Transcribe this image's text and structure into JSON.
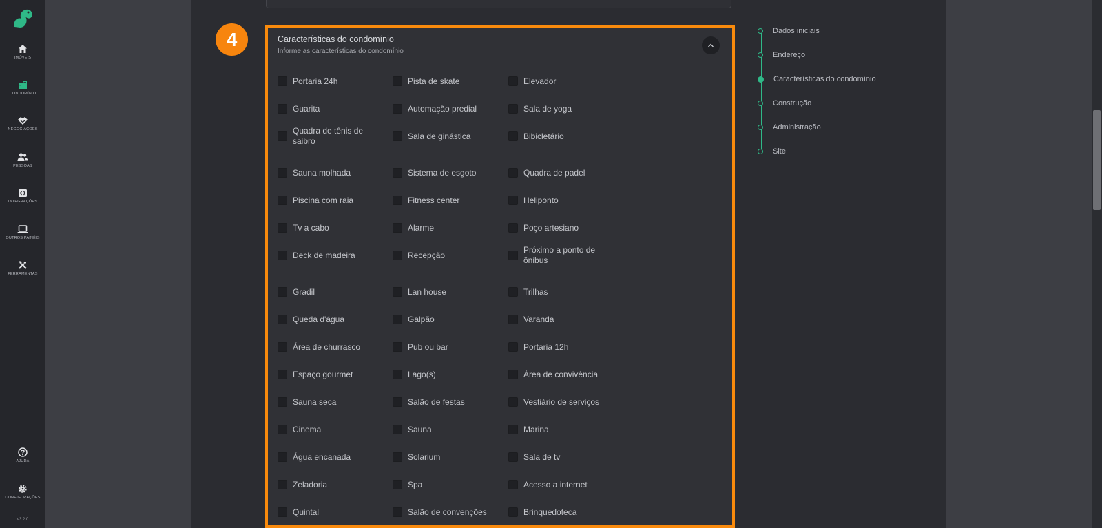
{
  "colors": {
    "accent": "#2fb887",
    "highlight": "#f98a0c",
    "sidebar_bg": "#25262b",
    "panel_bg": "#303136"
  },
  "sidebar": {
    "items": [
      {
        "label": "IMÓVEIS",
        "icon": "home-icon"
      },
      {
        "label": "CONDOMÍNIO",
        "icon": "building-icon",
        "active": true
      },
      {
        "label": "NEGOCIAÇÕES",
        "icon": "handshake-icon"
      },
      {
        "label": "PESSOAS",
        "icon": "people-icon"
      },
      {
        "label": "INTEGRAÇÕES",
        "icon": "integration-icon"
      },
      {
        "label": "OUTROS PAINÉIS",
        "icon": "laptop-icon"
      },
      {
        "label": "FERRAMENTAS",
        "icon": "tools-icon"
      }
    ],
    "bottom": [
      {
        "label": "AJUDA",
        "icon": "help-icon"
      },
      {
        "label": "CONFIGURAÇÕES",
        "icon": "gear-icon"
      }
    ],
    "version": "v3.2.0"
  },
  "step_badge": "4",
  "section": {
    "title": "Características do condomínio",
    "subtitle": "Informe as características do condomínio"
  },
  "features": {
    "col1": [
      "Portaria 24h",
      "Guarita",
      "Quadra de tênis de saibro",
      "Sauna molhada",
      "Piscina com raia",
      "Tv a cabo",
      "Deck de madeira",
      "Gradil",
      "Queda d'água",
      "Área de churrasco",
      "Espaço gourmet",
      "Sauna seca",
      "Cinema",
      "Água encanada",
      "Zeladoria",
      "Quintal"
    ],
    "col2": [
      "Pista de skate",
      "Automação predial",
      "Sala de ginástica",
      "Sistema de esgoto",
      "Fitness center",
      "Alarme",
      "Recepção",
      "Lan house",
      "Galpão",
      "Pub ou bar",
      "Lago(s)",
      "Salão de festas",
      "Sauna",
      "Solarium",
      "Spa",
      "Salão de convenções"
    ],
    "col3": [
      "Elevador",
      "Sala de yoga",
      "Bibicletário",
      "Quadra de padel",
      "Heliponto",
      "Poço artesiano",
      "Próximo a ponto de ônibus",
      "Trilhas",
      "Varanda",
      "Portaria 12h",
      "Área de convivência",
      "Vestiário de serviços",
      "Marina",
      "Sala de tv",
      "Acesso a internet",
      "Brinquedoteca"
    ]
  },
  "stepper": [
    {
      "label": "Dados iniciais"
    },
    {
      "label": "Endereço"
    },
    {
      "label": "Características do condomínio",
      "active": true
    },
    {
      "label": "Construção"
    },
    {
      "label": "Administração"
    },
    {
      "label": "Site"
    }
  ]
}
